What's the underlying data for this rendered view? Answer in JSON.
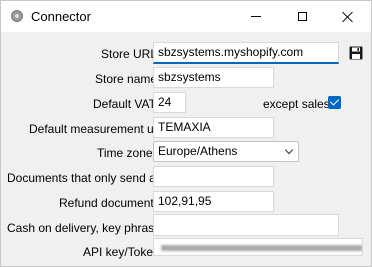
{
  "window": {
    "title": "Connector",
    "app_icon": "connector-app-icon",
    "controls": [
      "minimize-icon",
      "maximize-icon",
      "close-icon"
    ]
  },
  "form": {
    "store_url": {
      "label": "Store URL",
      "value": "sbzsystems.myshopify.com"
    },
    "store_name": {
      "label": "Store name",
      "value": "sbzsystems"
    },
    "default_vat": {
      "label": "Default VAT",
      "value": "24"
    },
    "except_sales": {
      "label": "except sales",
      "checked": true
    },
    "default_measurement_unit": {
      "label": "Default measurement unit",
      "value": "TEMAXIA"
    },
    "time_zone": {
      "label": "Time zone",
      "value": "Europe/Athens"
    },
    "documents_only_send": {
      "label": "Documents that only send a...",
      "value": ""
    },
    "refund_documents": {
      "label": "Refund documents",
      "value": "102,91,95"
    },
    "cash_on_delivery": {
      "label": "Cash on delivery, key phras...",
      "value": ""
    },
    "api_key": {
      "label": "API key/Token",
      "value": ""
    }
  },
  "toolbar": {
    "save_icon": "save-icon"
  },
  "colors": {
    "accent": "#0067c0",
    "window_bg": "#f0f0f0",
    "titlebar_bg": "#ffffff"
  }
}
